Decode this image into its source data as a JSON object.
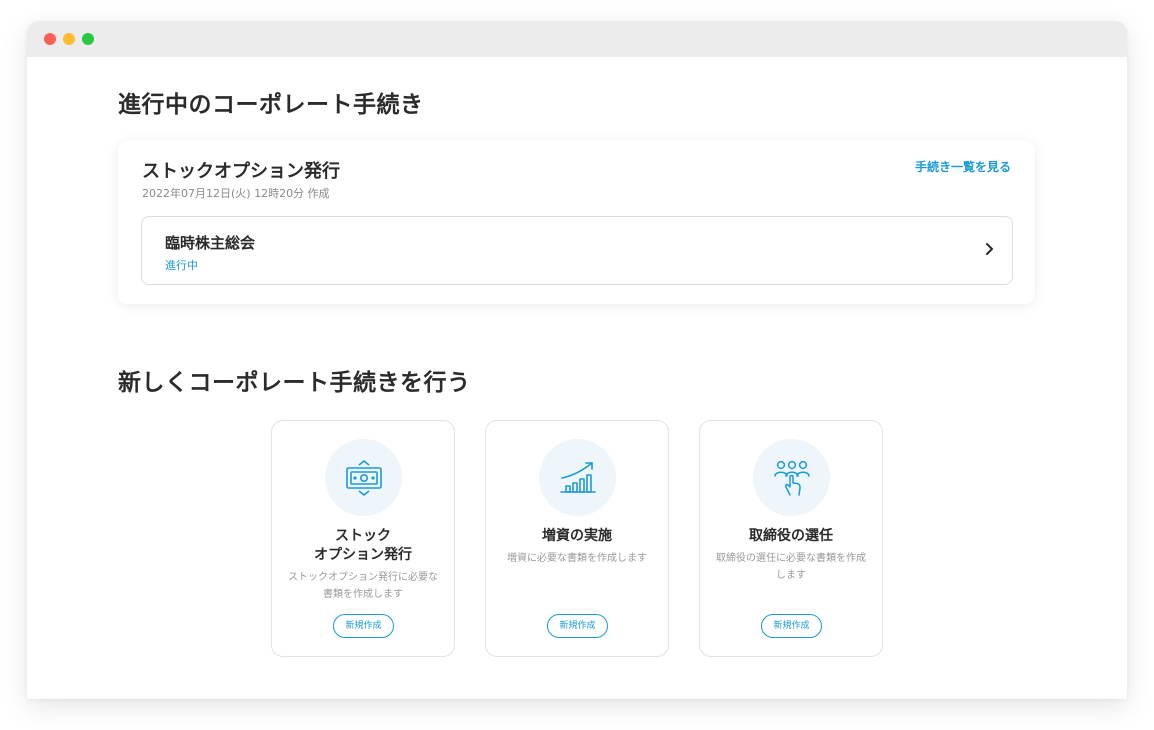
{
  "window": {
    "controls": [
      {
        "name": "close",
        "color": "#fe5f57"
      },
      {
        "name": "minimize",
        "color": "#febc2e"
      },
      {
        "name": "maximize",
        "color": "#28c840"
      }
    ]
  },
  "ongoing": {
    "title": "進行中のコーポレート手続き",
    "procedure_name": "ストックオプション発行",
    "created": "2022年07月12日(火) 12時20分 作成",
    "list_link": "手続き一覧を見る",
    "step": {
      "name": "臨時株主総会",
      "status": "進行中"
    }
  },
  "new_procedures": {
    "title": "新しくコーポレート手続きを行う",
    "cards": [
      {
        "title": "ストック\nオプション発行",
        "desc": "ストックオプション発行に必要な書類を作成します",
        "button": "新規作成",
        "icon": "money-exchange-icon"
      },
      {
        "title": "増資の実施",
        "desc": "増資に必要な書類を作成します",
        "button": "新規作成",
        "icon": "growth-chart-icon"
      },
      {
        "title": "取締役の選任",
        "desc": "取締役の選任に必要な書類を作成します",
        "button": "新規作成",
        "icon": "people-select-icon"
      }
    ]
  },
  "colors": {
    "accent": "#1a9bd7",
    "icon_bg": "#eef5fb",
    "text": "#2b2b2b",
    "muted": "#9a9a9a"
  }
}
